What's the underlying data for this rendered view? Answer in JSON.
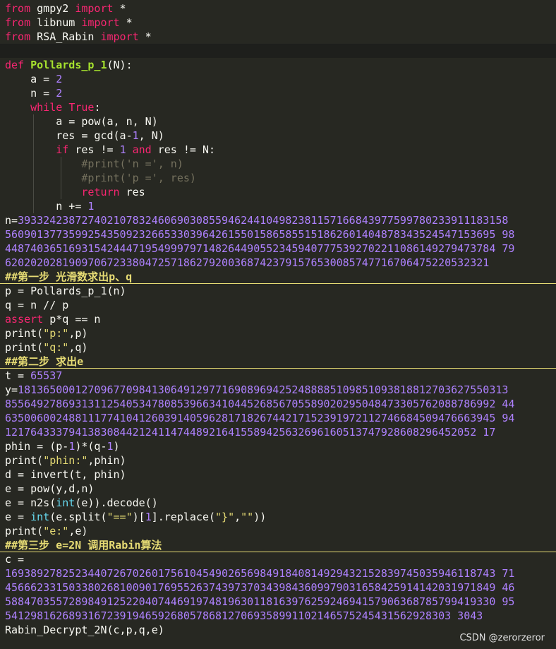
{
  "editor": {
    "lines": [
      {
        "name": "code-line-import-gmpy2",
        "tokens": [
          {
            "t": "from",
            "c": "kw"
          },
          {
            "t": " gmpy2 ",
            "c": ""
          },
          {
            "t": "import",
            "c": "kw"
          },
          {
            "t": " *",
            "c": ""
          }
        ]
      },
      {
        "name": "code-line-import-libnum",
        "tokens": [
          {
            "t": "from",
            "c": "kw"
          },
          {
            "t": " libnum ",
            "c": ""
          },
          {
            "t": "import",
            "c": "kw"
          },
          {
            "t": " *",
            "c": ""
          }
        ]
      },
      {
        "name": "code-line-import-rsa-rabin",
        "tokens": [
          {
            "t": "from",
            "c": "kw"
          },
          {
            "t": " RSA_Rabin ",
            "c": ""
          },
          {
            "t": "import",
            "c": "kw"
          },
          {
            "t": " *",
            "c": ""
          }
        ]
      },
      {
        "name": "code-line-blank",
        "cur": true,
        "tokens": []
      },
      {
        "name": "code-line-def-pollards",
        "tokens": [
          {
            "t": "def",
            "c": "kw"
          },
          {
            "t": " ",
            "c": ""
          },
          {
            "t": "Pollards_p_1",
            "c": "fn"
          },
          {
            "t": "(N):",
            "c": ""
          }
        ]
      },
      {
        "name": "code-line",
        "tokens": [
          {
            "t": "    a = ",
            "c": ""
          },
          {
            "t": "2",
            "c": "num"
          }
        ]
      },
      {
        "name": "code-line",
        "tokens": [
          {
            "t": "    n = ",
            "c": ""
          },
          {
            "t": "2",
            "c": "num"
          }
        ]
      },
      {
        "name": "code-line",
        "tokens": [
          {
            "t": "    ",
            "c": ""
          },
          {
            "t": "while",
            "c": "kw"
          },
          {
            "t": " ",
            "c": ""
          },
          {
            "t": "True",
            "c": "kw"
          },
          {
            "t": ":",
            "c": ""
          }
        ]
      },
      {
        "name": "code-line",
        "tokens": [
          {
            "t": "        a = pow(a, n, N)",
            "c": ""
          }
        ]
      },
      {
        "name": "code-line",
        "tokens": [
          {
            "t": "        res = gcd(a-",
            "c": ""
          },
          {
            "t": "1",
            "c": "num"
          },
          {
            "t": ", N)",
            "c": ""
          }
        ]
      },
      {
        "name": "code-line",
        "tokens": [
          {
            "t": "        ",
            "c": ""
          },
          {
            "t": "if",
            "c": "kw"
          },
          {
            "t": " res != ",
            "c": ""
          },
          {
            "t": "1",
            "c": "num"
          },
          {
            "t": " ",
            "c": ""
          },
          {
            "t": "and",
            "c": "kw"
          },
          {
            "t": " res != N:",
            "c": ""
          }
        ]
      },
      {
        "name": "code-line-comment",
        "tokens": [
          {
            "t": "            #print('n =', n)",
            "c": "cmt"
          }
        ]
      },
      {
        "name": "code-line-comment",
        "tokens": [
          {
            "t": "            #print('p =', res)",
            "c": "cmt"
          }
        ]
      },
      {
        "name": "code-line",
        "tokens": [
          {
            "t": "            ",
            "c": ""
          },
          {
            "t": "return",
            "c": "kw"
          },
          {
            "t": " res",
            "c": ""
          }
        ]
      },
      {
        "name": "code-line",
        "tokens": [
          {
            "t": "        n += ",
            "c": ""
          },
          {
            "t": "1",
            "c": "num"
          }
        ]
      },
      {
        "name": "code-line-n-value",
        "tokens": [
          {
            "t": "n=",
            "c": ""
          },
          {
            "t": "39332423872740210783246069030855946244104982381157166843977599780233911183158",
            "c": "num"
          }
        ]
      },
      {
        "name": "code-line-n-value",
        "tokens": [
          {
            "t": "56090137735992543509232665330396426155015865855151862601404878343524547153695 98",
            "c": "num"
          }
        ]
      },
      {
        "name": "code-line-n-value",
        "tokens": [
          {
            "t": "44874036516931542444719549997971482644905523459407775392702211086149279473784 79",
            "c": "num"
          }
        ]
      },
      {
        "name": "code-line-n-value",
        "tokens": [
          {
            "t": "6202020281909706723380472571862792003687423791576530085747716706475220532321",
            "c": "num"
          }
        ]
      },
      {
        "name": "section-heading-1",
        "hdr": true,
        "tokens": [
          {
            "t": "##第一步 光滑数求出p、q",
            "c": "heading"
          }
        ]
      },
      {
        "name": "code-line",
        "tokens": [
          {
            "t": "p = Pollards_p_1(n)",
            "c": ""
          }
        ]
      },
      {
        "name": "code-line",
        "tokens": [
          {
            "t": "q = n // p",
            "c": ""
          }
        ]
      },
      {
        "name": "code-line",
        "tokens": [
          {
            "t": "assert",
            "c": "kw"
          },
          {
            "t": " p*q == n",
            "c": ""
          }
        ]
      },
      {
        "name": "code-line",
        "tokens": [
          {
            "t": "print(",
            "c": ""
          },
          {
            "t": "\"p:\"",
            "c": "str"
          },
          {
            "t": ",p)",
            "c": ""
          }
        ]
      },
      {
        "name": "code-line",
        "tokens": [
          {
            "t": "print(",
            "c": ""
          },
          {
            "t": "\"q:\"",
            "c": "str"
          },
          {
            "t": ",q)",
            "c": ""
          }
        ]
      },
      {
        "name": "section-heading-2",
        "hdr": true,
        "tokens": [
          {
            "t": "##第二步 求出e",
            "c": "heading"
          }
        ]
      },
      {
        "name": "code-line",
        "tokens": [
          {
            "t": "t = ",
            "c": ""
          },
          {
            "t": "65537",
            "c": "num"
          }
        ]
      },
      {
        "name": "code-line-y-value",
        "tokens": [
          {
            "t": "y=",
            "c": ""
          },
          {
            "t": "18136500012709677098413064912977169089694252488885109851093818812703627550313",
            "c": "num"
          }
        ]
      },
      {
        "name": "code-line-y-value",
        "tokens": [
          {
            "t": "85564927869313112540534780853966341044526856705589020295048473305762088786992 44",
            "c": "num"
          }
        ]
      },
      {
        "name": "code-line-y-value",
        "tokens": [
          {
            "t": "63500600248811177410412603914059628171826744217152391972112746684509476663945 94",
            "c": "num"
          }
        ]
      },
      {
        "name": "code-line-y-value",
        "tokens": [
          {
            "t": "12176433379413830844212411474489216415589425632696160513747928608296452052 17",
            "c": "num"
          }
        ]
      },
      {
        "name": "code-line",
        "tokens": [
          {
            "t": "phin = (p-",
            "c": ""
          },
          {
            "t": "1",
            "c": "num"
          },
          {
            "t": ")*(q-",
            "c": ""
          },
          {
            "t": "1",
            "c": "num"
          },
          {
            "t": ")",
            "c": ""
          }
        ]
      },
      {
        "name": "code-line",
        "tokens": [
          {
            "t": "print(",
            "c": ""
          },
          {
            "t": "\"phin:\"",
            "c": "str"
          },
          {
            "t": ",phin)",
            "c": ""
          }
        ]
      },
      {
        "name": "code-line",
        "tokens": [
          {
            "t": "d = invert(t, phin)",
            "c": ""
          }
        ]
      },
      {
        "name": "code-line",
        "tokens": [
          {
            "t": "e = pow(y,d,n)",
            "c": ""
          }
        ]
      },
      {
        "name": "code-line",
        "tokens": [
          {
            "t": "e = n2s(",
            "c": ""
          },
          {
            "t": "int",
            "c": "builtin"
          },
          {
            "t": "(e)).decode()",
            "c": ""
          }
        ]
      },
      {
        "name": "code-line",
        "tokens": [
          {
            "t": "e = ",
            "c": ""
          },
          {
            "t": "int",
            "c": "builtin"
          },
          {
            "t": "(e.split(",
            "c": ""
          },
          {
            "t": "\"==\"",
            "c": "str"
          },
          {
            "t": ")[",
            "c": ""
          },
          {
            "t": "1",
            "c": "num"
          },
          {
            "t": "].replace(",
            "c": ""
          },
          {
            "t": "\"}\"",
            "c": "str"
          },
          {
            "t": ",",
            "c": ""
          },
          {
            "t": "\"\"",
            "c": "str"
          },
          {
            "t": "))",
            "c": ""
          }
        ]
      },
      {
        "name": "code-line",
        "tokens": [
          {
            "t": "print(",
            "c": ""
          },
          {
            "t": "\"e:\"",
            "c": "str"
          },
          {
            "t": ",e)",
            "c": ""
          }
        ]
      },
      {
        "name": "section-heading-3",
        "hdr": true,
        "tokens": [
          {
            "t": "##第三步 e=2N 调用Rabin算法",
            "c": "heading"
          }
        ]
      },
      {
        "name": "code-line",
        "tokens": [
          {
            "t": "c =",
            "c": ""
          }
        ]
      },
      {
        "name": "code-line-c-value",
        "tokens": [
          {
            "t": "16938927825234407267026017561045490265698491840814929432152839745035946118743 71",
            "c": "num"
          }
        ]
      },
      {
        "name": "code-line-c-value",
        "tokens": [
          {
            "t": "45666233150338026810090176955263743973703439843609979031658425914142031971849 46",
            "c": "num"
          }
        ]
      },
      {
        "name": "code-line-c-value",
        "tokens": [
          {
            "t": "58847035572898491252204074469197481963011816397625924694157906368785799419330 95",
            "c": "num"
          }
        ]
      },
      {
        "name": "code-line-c-value",
        "tokens": [
          {
            "t": "5412981626893167239194659268057868127069358991102146575245431562928303 3043",
            "c": "num"
          }
        ]
      },
      {
        "name": "code-line",
        "tokens": [
          {
            "t": "Rabin_Decrypt_2N(c,p,q,e)",
            "c": ""
          }
        ]
      }
    ]
  },
  "watermark": "CSDN @zerorzeror",
  "colors": {
    "background": "#272822",
    "keyword": "#F92672",
    "function": "#A6E22E",
    "number": "#AE81FF",
    "string": "#E6DB74",
    "comment": "#75715E"
  }
}
